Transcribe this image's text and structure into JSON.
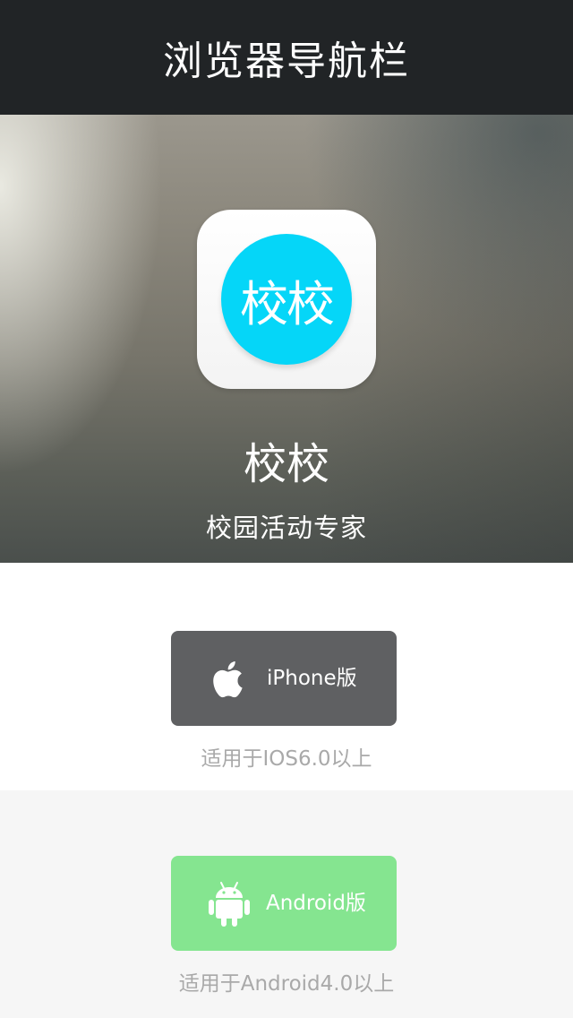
{
  "navbar": {
    "title": "浏览器导航栏"
  },
  "hero": {
    "icon_text": "校校",
    "app_name": "校校",
    "tagline": "校园活动专家"
  },
  "ios": {
    "button_label": "iPhone版",
    "requirement": "适用于IOS6.0以上",
    "icon": "apple-icon"
  },
  "android": {
    "button_label": "Android版",
    "requirement": "适用于Android4.0以上",
    "icon": "android-icon"
  },
  "colors": {
    "navbar_bg": "#212426",
    "icon_accent": "#05d6f8",
    "ios_button": "#5f6062",
    "android_button": "#85e590",
    "requirement_text": "#a9a9a9"
  }
}
